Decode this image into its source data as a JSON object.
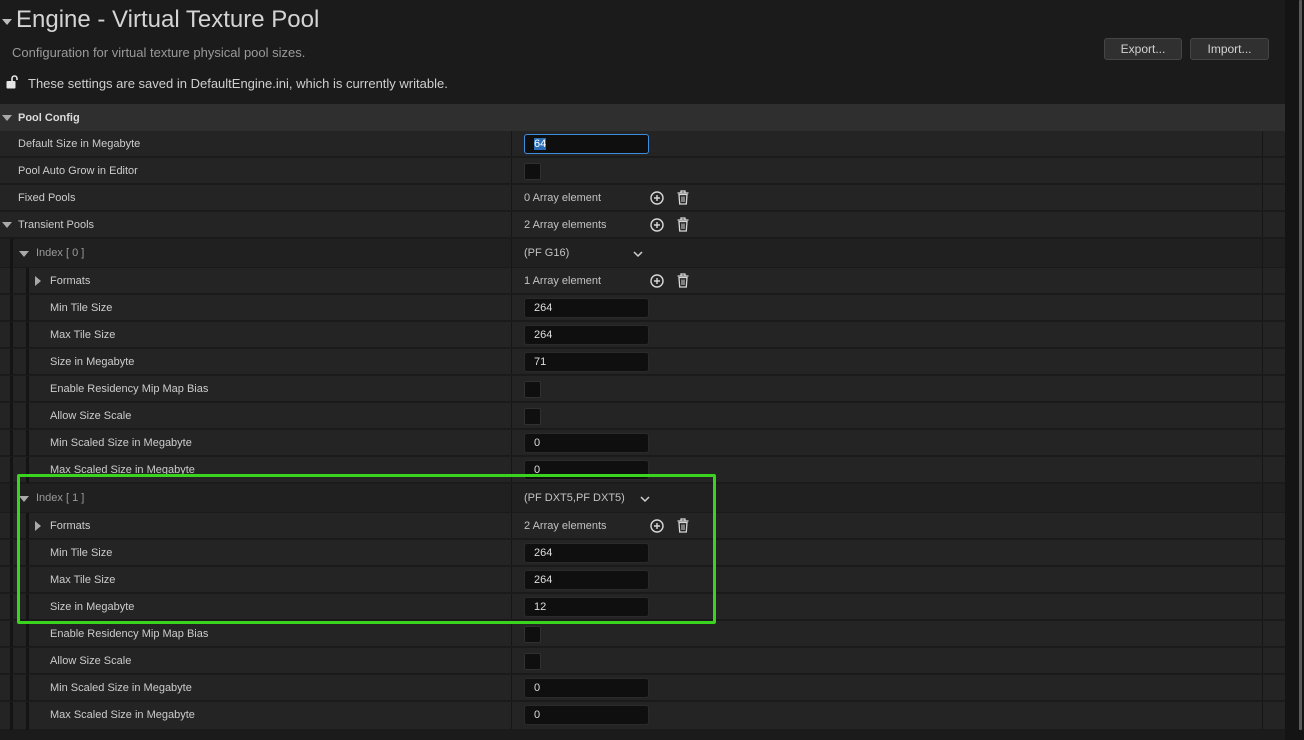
{
  "header": {
    "title": "Engine - Virtual Texture Pool",
    "subtitle": "Configuration for virtual texture physical pool sizes.",
    "export_label": "Export...",
    "import_label": "Import...",
    "writable_notice": "These settings are saved in DefaultEngine.ini, which is currently writable."
  },
  "pool_config": {
    "category": "Pool Config",
    "default_size": {
      "label": "Default Size in Megabyte",
      "value": "64"
    },
    "auto_grow": {
      "label": "Pool Auto Grow in Editor"
    },
    "fixed_pools": {
      "label": "Fixed Pools",
      "count": "0 Array element"
    },
    "transient_pools": {
      "label": "Transient Pools",
      "count": "2 Array elements"
    }
  },
  "index0": {
    "label": "Index [ 0 ]",
    "value": "(PF G16)",
    "formats": {
      "label": "Formats",
      "count": "1 Array element"
    },
    "min_tile": {
      "label": "Min Tile Size",
      "value": "264"
    },
    "max_tile": {
      "label": "Max Tile Size",
      "value": "264"
    },
    "size_mb": {
      "label": "Size in Megabyte",
      "value": "71"
    },
    "residency": {
      "label": "Enable Residency Mip Map Bias"
    },
    "allow_scale": {
      "label": "Allow Size Scale"
    },
    "min_scaled": {
      "label": "Min Scaled Size in Megabyte",
      "value": "0"
    },
    "max_scaled": {
      "label": "Max Scaled Size in Megabyte",
      "value": "0"
    }
  },
  "index1": {
    "label": "Index [ 1 ]",
    "value": "(PF DXT5,PF DXT5)",
    "formats": {
      "label": "Formats",
      "count": "2 Array elements"
    },
    "min_tile": {
      "label": "Min Tile Size",
      "value": "264"
    },
    "max_tile": {
      "label": "Max Tile Size",
      "value": "264"
    },
    "size_mb": {
      "label": "Size in Megabyte",
      "value": "12"
    },
    "residency": {
      "label": "Enable Residency Mip Map Bias"
    },
    "allow_scale": {
      "label": "Allow Size Scale"
    },
    "min_scaled": {
      "label": "Min Scaled Size in Megabyte",
      "value": "0"
    },
    "max_scaled": {
      "label": "Max Scaled Size in Megabyte",
      "value": "0"
    }
  },
  "colors": {
    "highlight": "#3ad41e",
    "focus": "#3b8ddd"
  },
  "icons": [
    "lock-open-icon",
    "add-element-icon",
    "delete-icon",
    "chevron-down-icon",
    "expand-arrow-icon"
  ]
}
